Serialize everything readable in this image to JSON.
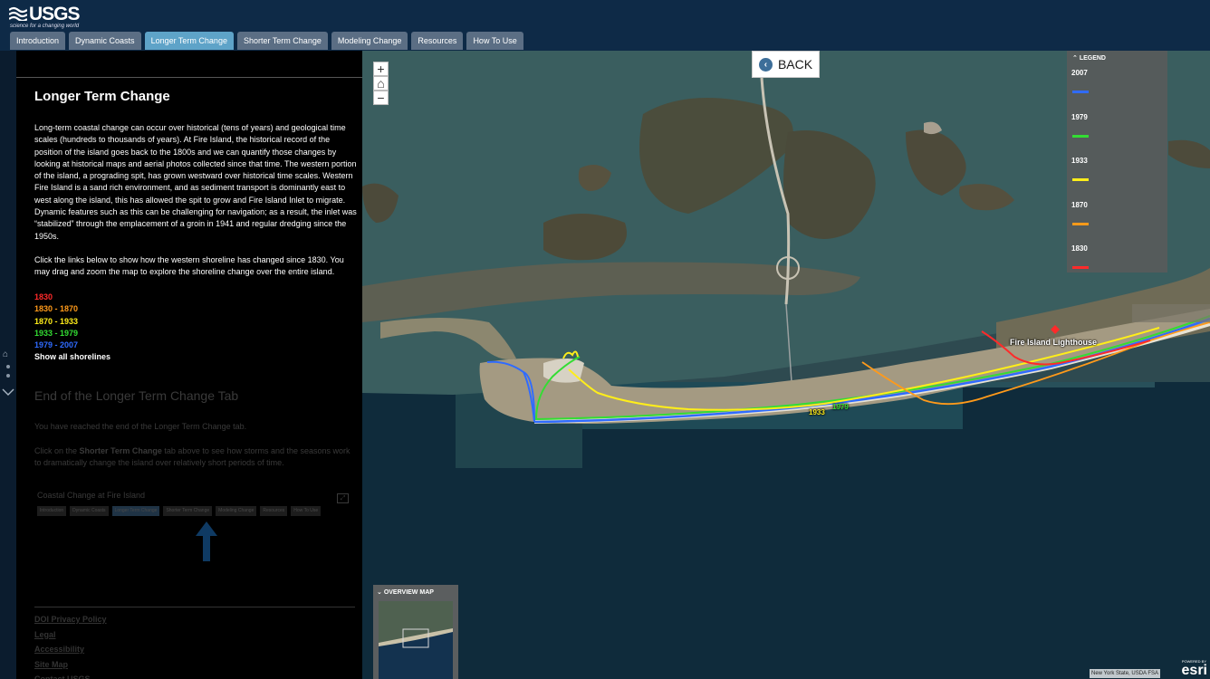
{
  "header": {
    "logo_text": "USGS",
    "logo_tagline": "science for a changing world",
    "tabs": [
      {
        "label": "Introduction",
        "active": false
      },
      {
        "label": "Dynamic Coasts",
        "active": false
      },
      {
        "label": "Longer Term Change",
        "active": true
      },
      {
        "label": "Shorter Term Change",
        "active": false
      },
      {
        "label": "Modeling Change",
        "active": false
      },
      {
        "label": "Resources",
        "active": false
      },
      {
        "label": "How To Use",
        "active": false
      }
    ]
  },
  "panel": {
    "title": "Longer Term Change",
    "paragraph1": "Long-term coastal change can occur over historical (tens of years) and geological time scales (hundreds to thousands of years). At Fire Island, the historical record of the position of the island goes back to the 1800s and we can quantify those changes by looking at historical maps and aerial photos collected since that time. The western portion of the island, a prograding spit, has grown westward over historical time scales. Western Fire Island is a sand rich environment, and as sediment transport is dominantly east to west along the island, this has allowed the spit to grow and Fire Island Inlet to migrate. Dynamic features such as this can be challenging for navigation; as a result, the inlet was “stabilized” through the emplacement of a groin in 1941 and regular dredging since the 1950s.",
    "paragraph2": "Click the links below to show how the western shoreline has changed since 1830. You may drag and zoom the map to explore the shoreline change over the entire island.",
    "links": [
      {
        "label": "1830",
        "color": "#ff2a2a"
      },
      {
        "label": "1830 - 1870",
        "color": "#ff9a1a"
      },
      {
        "label": "1870 - 1933",
        "color": "#ffee1a"
      },
      {
        "label": "1933 - 1979",
        "color": "#33dd33"
      },
      {
        "label": "1979 - 2007",
        "color": "#2f6bff"
      },
      {
        "label": "Show all shorelines",
        "color": "#ffffff"
      }
    ],
    "end_title": "End of the Longer Term Change Tab",
    "end_paragraph1": "You have reached the end of the Longer Term Change tab.",
    "end_paragraph2_before": "Click on the ",
    "end_paragraph2_bold": "Shorter Term Change",
    "end_paragraph2_after": " tab above to see how storms and the seasons work to dramatically change the island over relatively short periods of time.",
    "inset_title": "Coastal Change at Fire Island",
    "inset_tabs": [
      {
        "label": "Introduction",
        "active": false
      },
      {
        "label": "Dynamic Coasts",
        "active": false
      },
      {
        "label": "Longer Term Change",
        "active": true
      },
      {
        "label": "Shorter Term Change",
        "active": false
      },
      {
        "label": "Modeling Change",
        "active": false
      },
      {
        "label": "Resources",
        "active": false
      },
      {
        "label": "How To Use",
        "active": false
      }
    ],
    "footer_links": [
      "DOI Privacy Policy",
      "Legal",
      "Accessibility",
      "Site Map",
      "Contact USGS"
    ]
  },
  "map": {
    "back_label": "BACK",
    "zoom_in": "+",
    "zoom_out": "−",
    "legend_title": "LEGEND",
    "legend": [
      {
        "label": "2007",
        "color": "#2f6bff"
      },
      {
        "label": "1979",
        "color": "#33dd33"
      },
      {
        "label": "1933",
        "color": "#ffee1a"
      },
      {
        "label": "1870",
        "color": "#ff9a1a"
      },
      {
        "label": "1830",
        "color": "#ff2a2a"
      }
    ],
    "overview_title": "OVERVIEW MAP",
    "attribution": "New York State, USDA FSA",
    "esri_powered": "POWERED BY",
    "esri_word": "esri",
    "labels": {
      "lighthouse": "Fire Island Lighthouse",
      "year_1933": "1933",
      "year_1979": "1979"
    }
  }
}
